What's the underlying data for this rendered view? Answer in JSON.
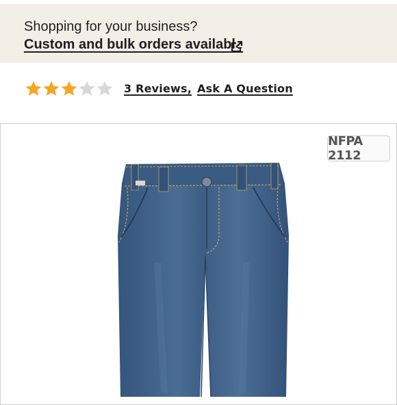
{
  "banner": {
    "prompt": "Shopping for your business?",
    "link_label": "Custom and bulk orders available",
    "link_icon": "external-link-icon"
  },
  "rating": {
    "stars_filled": 3,
    "stars_total": 5,
    "star_color": "#f5a623",
    "star_empty_color": "#d8d8d8",
    "reviews_label": "3 Reviews,",
    "question_label": "Ask A Question"
  },
  "product": {
    "badge": "NFPA 2112",
    "image": "denim-work-jeans"
  },
  "colors": {
    "banner_bg": "#f3eee6",
    "denim": "#3f5f85"
  }
}
